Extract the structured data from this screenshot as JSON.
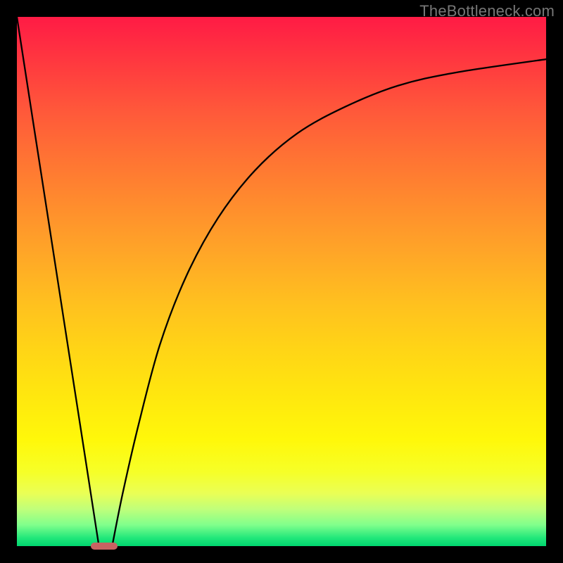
{
  "watermark": {
    "text": "TheBottleneck.com"
  },
  "chart_data": {
    "type": "line",
    "title": "",
    "xlabel": "",
    "ylabel": "",
    "xlim": [
      0,
      100
    ],
    "ylim": [
      0,
      100
    ],
    "grid": false,
    "legend": false,
    "background_gradient": {
      "direction": "vertical",
      "stops": [
        {
          "pos": 0.0,
          "color": "#ff1b45"
        },
        {
          "pos": 0.5,
          "color": "#ffb522"
        },
        {
          "pos": 0.8,
          "color": "#fff80a"
        },
        {
          "pos": 0.96,
          "color": "#80ff8c"
        },
        {
          "pos": 1.0,
          "color": "#00d56f"
        }
      ]
    },
    "series": [
      {
        "name": "left-branch",
        "x": [
          0,
          3,
          6,
          9,
          12,
          14,
          15.5
        ],
        "values": [
          100,
          80.6,
          61.3,
          41.9,
          22.6,
          9.7,
          0
        ]
      },
      {
        "name": "right-branch",
        "x": [
          18,
          20,
          23,
          27,
          32,
          38,
          45,
          53,
          62,
          72,
          83,
          100
        ],
        "values": [
          0,
          10,
          23,
          38,
          51,
          62,
          71,
          78,
          83,
          87,
          89.5,
          92
        ]
      }
    ],
    "marker": {
      "x": 16.5,
      "y": 0,
      "width_pct": 5.0,
      "height_pct": 1.3,
      "color": "#c86262"
    }
  }
}
